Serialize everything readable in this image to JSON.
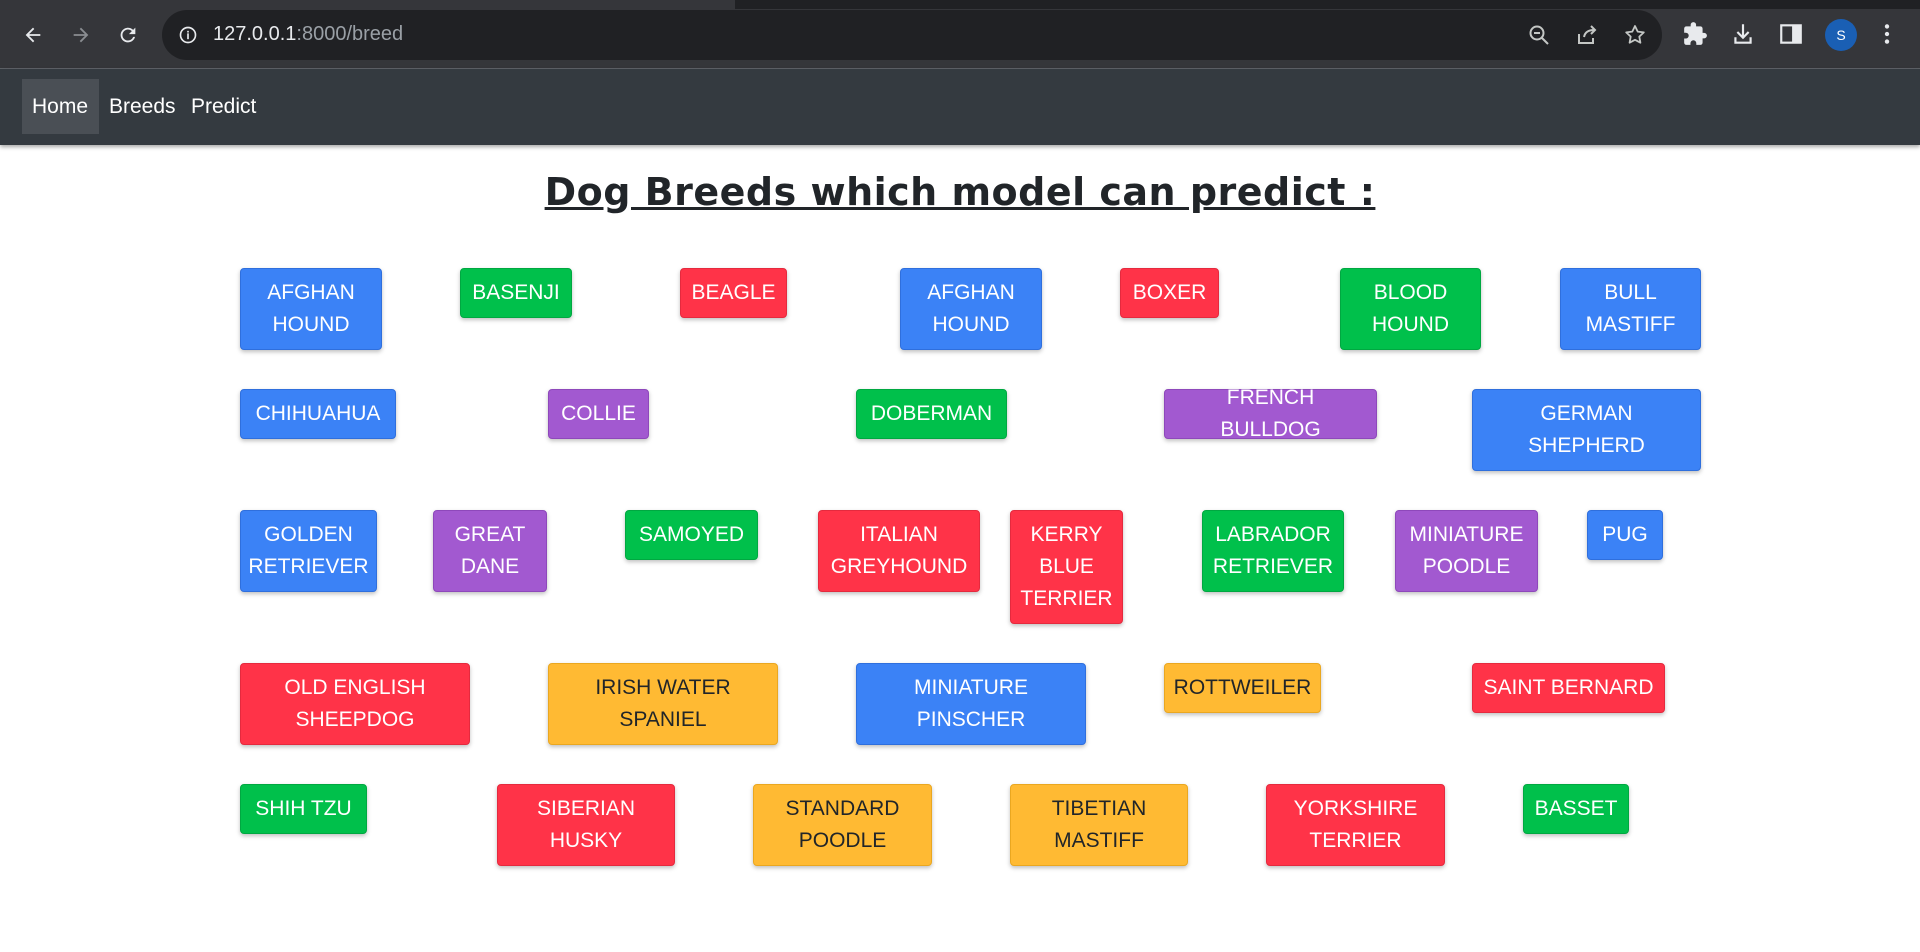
{
  "browser": {
    "url_host": "127.0.0.1",
    "url_path": ":8000/breed",
    "profile_initial": "S"
  },
  "navbar": {
    "items": [
      {
        "label": "Home"
      },
      {
        "label": "Breeds"
      },
      {
        "label": "Predict"
      }
    ]
  },
  "page": {
    "title": "Dog Breeds which model can predict :"
  },
  "colors": {
    "blue": "#3b82f6",
    "green": "#00c04b",
    "red": "#ff3348",
    "purple": "#a259d0",
    "yellow": "#ffba33"
  },
  "breeds": [
    {
      "label": "AFGHAN HOUND",
      "color": "blue"
    },
    {
      "label": "BASENJI",
      "color": "green"
    },
    {
      "label": "BEAGLE",
      "color": "red"
    },
    {
      "label": "AFGHAN HOUND",
      "color": "blue"
    },
    {
      "label": "BOXER",
      "color": "red"
    },
    {
      "label": "BLOOD HOUND",
      "color": "green"
    },
    {
      "label": "BULL MASTIFF",
      "color": "blue"
    },
    {
      "label": "CHIHUAHUA",
      "color": "blue"
    },
    {
      "label": "COLLIE",
      "color": "purple"
    },
    {
      "label": "DOBERMAN",
      "color": "green"
    },
    {
      "label": "FRENCH BULLDOG",
      "color": "purple"
    },
    {
      "label": "GERMAN SHEPHERD",
      "color": "blue"
    },
    {
      "label": "GOLDEN RETRIEVER",
      "color": "blue"
    },
    {
      "label": "GREAT DANE",
      "color": "purple"
    },
    {
      "label": "SAMOYED",
      "color": "green"
    },
    {
      "label": "ITALIAN GREYHOUND",
      "color": "red"
    },
    {
      "label": "KERRY BLUE TERRIER",
      "color": "red"
    },
    {
      "label": "LABRADOR RETRIEVER",
      "color": "green"
    },
    {
      "label": "MINIATURE POODLE",
      "color": "purple"
    },
    {
      "label": "PUG",
      "color": "blue"
    },
    {
      "label": "OLD ENGLISH SHEEPDOG",
      "color": "red"
    },
    {
      "label": "IRISH WATER SPANIEL",
      "color": "yellow"
    },
    {
      "label": "MINIATURE PINSCHER",
      "color": "blue"
    },
    {
      "label": "ROTTWEILER",
      "color": "yellow"
    },
    {
      "label": "SAINT BERNARD",
      "color": "red"
    },
    {
      "label": "SHIH TZU",
      "color": "green"
    },
    {
      "label": "SIBERIAN HUSKY",
      "color": "red"
    },
    {
      "label": "STANDARD POODLE",
      "color": "yellow"
    },
    {
      "label": "TIBETIAN MASTIFF",
      "color": "yellow"
    },
    {
      "label": "YORKSHIRE TERRIER",
      "color": "red"
    },
    {
      "label": "BASSET",
      "color": "green"
    }
  ]
}
